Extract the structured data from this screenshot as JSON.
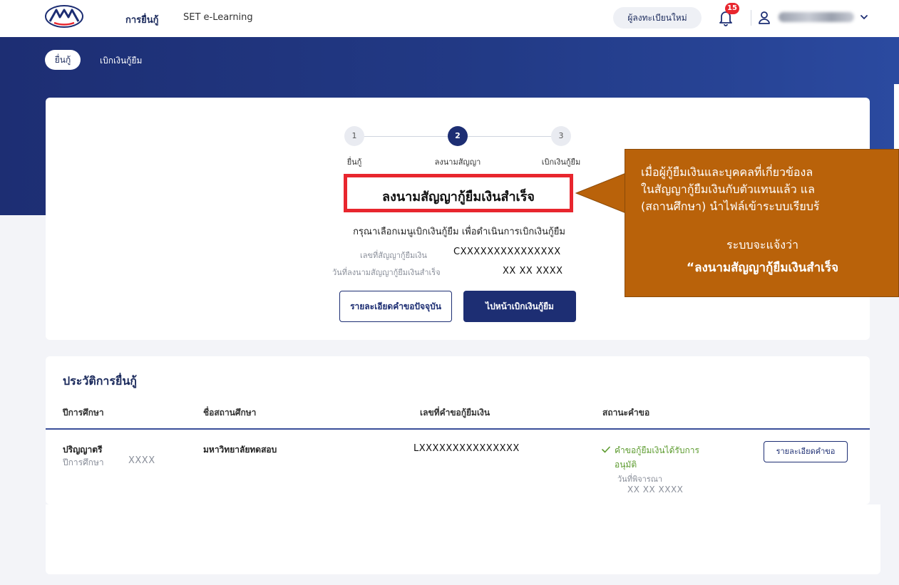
{
  "header": {
    "nav": [
      "การยื่นกู้",
      "SET e-Learning"
    ],
    "register_label": "ผู้ลงทะเบียนใหม่",
    "notification_count": "15",
    "user_icon": "user-icon",
    "bell_icon": "bell-icon"
  },
  "tabs": [
    "ยื่นกู้",
    "เบิกเงินกู้ยืม"
  ],
  "stepper": {
    "steps": [
      {
        "number": "1",
        "label": "ยื่นกู้",
        "state": "done"
      },
      {
        "number": "2",
        "label": "ลงนามสัญญา",
        "state": "active"
      },
      {
        "number": "3",
        "label": "เบิกเงินกู้ยืม",
        "state": "pending"
      }
    ]
  },
  "status": {
    "title": "ลงนามสัญญากู้ยืมเงินสำเร็จ",
    "instruction": "กรุณาเลือกเมนูเบิกเงินกู้ยืม เพื่อดำเนินการเบิกเงินกู้ยืม",
    "contract_label": "เลขที่สัญญากู้ยืมเงิน",
    "contract_value": "CXXXXXXXXXXXXXXX",
    "date_label": "วันที่ลงนามสัญญากู้ยืมเงินสำเร็จ",
    "date_value": "XX XX XXXX"
  },
  "buttons": {
    "current_detail": "รายละเอียดคำขอปัจจุบัน",
    "go_disburse": "ไปหน้าเบิกเงินกู้ยืม"
  },
  "callout": {
    "lines": [
      "เมื่อผู้กู้ยืมเงินและบุคคลที่เกี่ยวข้องล",
      "ในสัญญากู้ยืมเงินกับตัวแทนแล้ว แล",
      "(สถานศึกษา) นำไฟล์เข้าระบบเรียบร้"
    ],
    "line4": "ระบบจะแจ้งว่า",
    "line5": "“ลงนามสัญญากู้ยืมเงินสำเร็จ"
  },
  "history": {
    "title": "ประวัติการยื่นกู้",
    "columns": [
      "ปีการศึกษา",
      "ชื่อสถานศึกษา",
      "เลขที่คำขอกู้ยืมเงิน",
      "สถานะคำขอ"
    ],
    "row": {
      "level": "ปริญญาตรี",
      "year_label": "ปีการศึกษา",
      "year_value": "XXXX",
      "school": "มหาวิทยาลัยทดสอบ",
      "request_no": "LXXXXXXXXXXXXXXX",
      "status_line1": "คำขอกู้ยืมเงินได้รับการ",
      "status_line2": "อนุมัติ",
      "review_label": "วันที่พิจารณา",
      "review_date": "XX XX XXXX",
      "detail_button": "รายละเอียดคำขอ"
    }
  },
  "colors": {
    "primary": "#1d2e73",
    "highlight": "#e8262e",
    "callout": "#b9620a",
    "approved": "#5c9b2e"
  }
}
